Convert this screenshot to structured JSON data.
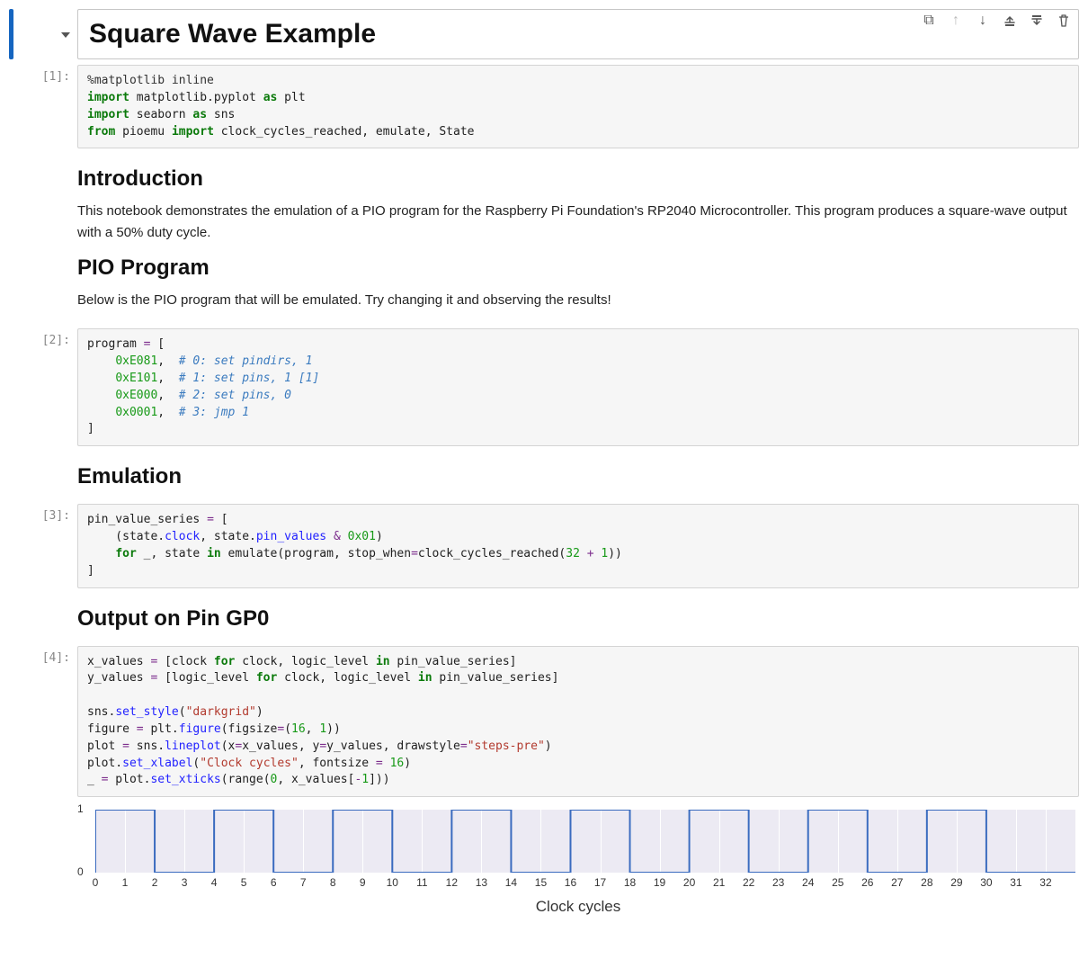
{
  "title_cell": {
    "heading": "Square Wave Example"
  },
  "toolbar": {
    "duplicate": "duplicate-icon",
    "move_up": "arrow-up-icon",
    "move_down": "arrow-down-icon",
    "insert_above": "insert-above-icon",
    "insert_below": "insert-below-icon",
    "delete": "trash-icon"
  },
  "cells": {
    "c1": {
      "prompt": "[1]:",
      "code_html": "<span class='magic'>%matplotlib inline</span>\n<span class='kw'>import</span> matplotlib.pyplot <span class='kw'>as</span> plt\n<span class='kw'>import</span> seaborn <span class='kw'>as</span> sns\n<span class='kw'>from</span> pioemu <span class='kw'>import</span> clock_cycles_reached, emulate, State"
    },
    "md1": {
      "heading": "Introduction",
      "body": "This notebook demonstrates the emulation of a PIO program for the Raspberry Pi Foundation's RP2040 Microcontroller. This program produces a square-wave output with a 50% duty cycle."
    },
    "md2": {
      "heading": "PIO Program",
      "body": "Below is the PIO program that will be emulated. Try changing it and observing the results!"
    },
    "c2": {
      "prompt": "[2]:",
      "code_html": "program <span class='op'>=</span> [\n    <span class='num'>0xE081</span>,  <span class='cm'># 0: set pindirs, 1</span>\n    <span class='num'>0xE101</span>,  <span class='cm'># 1: set pins, 1 [1]</span>\n    <span class='num'>0xE000</span>,  <span class='cm'># 2: set pins, 0</span>\n    <span class='num'>0x0001</span>,  <span class='cm'># 3: jmp 1</span>\n]"
    },
    "md3": {
      "heading": "Emulation"
    },
    "c3": {
      "prompt": "[3]:",
      "code_html": "pin_value_series <span class='op'>=</span> [\n    (state.<span class='fn'>clock</span>, state.<span class='fn'>pin_values</span> <span class='op'>&amp;</span> <span class='num'>0x01</span>)\n    <span class='kw'>for</span> _, state <span class='kw'>in</span> emulate(program, stop_when<span class='op'>=</span>clock_cycles_reached(<span class='num'>32</span> <span class='op'>+</span> <span class='num'>1</span>))\n]"
    },
    "md4": {
      "heading": "Output on Pin GP0"
    },
    "c4": {
      "prompt": "[4]:",
      "code_html": "x_values <span class='op'>=</span> [clock <span class='kw'>for</span> clock, logic_level <span class='kw'>in</span> pin_value_series]\ny_values <span class='op'>=</span> [logic_level <span class='kw'>for</span> clock, logic_level <span class='kw'>in</span> pin_value_series]\n\nsns.<span class='fn'>set_style</span>(<span class='str'>\"darkgrid\"</span>)\nfigure <span class='op'>=</span> plt.<span class='fn'>figure</span>(figsize<span class='op'>=</span>(<span class='num'>16</span>, <span class='num'>1</span>))\nplot <span class='op'>=</span> sns.<span class='fn'>lineplot</span>(x<span class='op'>=</span>x_values, y<span class='op'>=</span>y_values, drawstyle<span class='op'>=</span><span class='str'>\"steps-pre\"</span>)\nplot.<span class='fn'>set_xlabel</span>(<span class='str'>\"Clock cycles\"</span>, fontsize <span class='op'>=</span> <span class='num'>16</span>)\n_ <span class='op'>=</span> plot.<span class='fn'>set_xticks</span>(range(<span class='num'>0</span>, x_values[<span class='op'>-</span><span class='num'>1</span>]))"
    }
  },
  "chart_data": {
    "type": "line",
    "title": "",
    "xlabel": "Clock cycles",
    "ylabel": "",
    "ylim": [
      0,
      1
    ],
    "xlim": [
      0,
      33
    ],
    "x_ticks": [
      0,
      1,
      2,
      3,
      4,
      5,
      6,
      7,
      8,
      9,
      10,
      11,
      12,
      13,
      14,
      15,
      16,
      17,
      18,
      19,
      20,
      21,
      22,
      23,
      24,
      25,
      26,
      27,
      28,
      29,
      30,
      31,
      32
    ],
    "y_ticks": [
      0,
      1
    ],
    "x": [
      0,
      1,
      2,
      3,
      4,
      5,
      6,
      7,
      8,
      9,
      10,
      11,
      12,
      13,
      14,
      15,
      16,
      17,
      18,
      19,
      20,
      21,
      22,
      23,
      24,
      25,
      26,
      27,
      28,
      29,
      30,
      31,
      32,
      33
    ],
    "y": [
      0,
      1,
      1,
      0,
      0,
      1,
      1,
      0,
      0,
      1,
      1,
      0,
      0,
      1,
      1,
      0,
      0,
      1,
      1,
      0,
      0,
      1,
      1,
      0,
      0,
      1,
      1,
      0,
      0,
      1,
      1,
      0,
      0,
      0
    ],
    "drawstyle": "steps-pre"
  }
}
